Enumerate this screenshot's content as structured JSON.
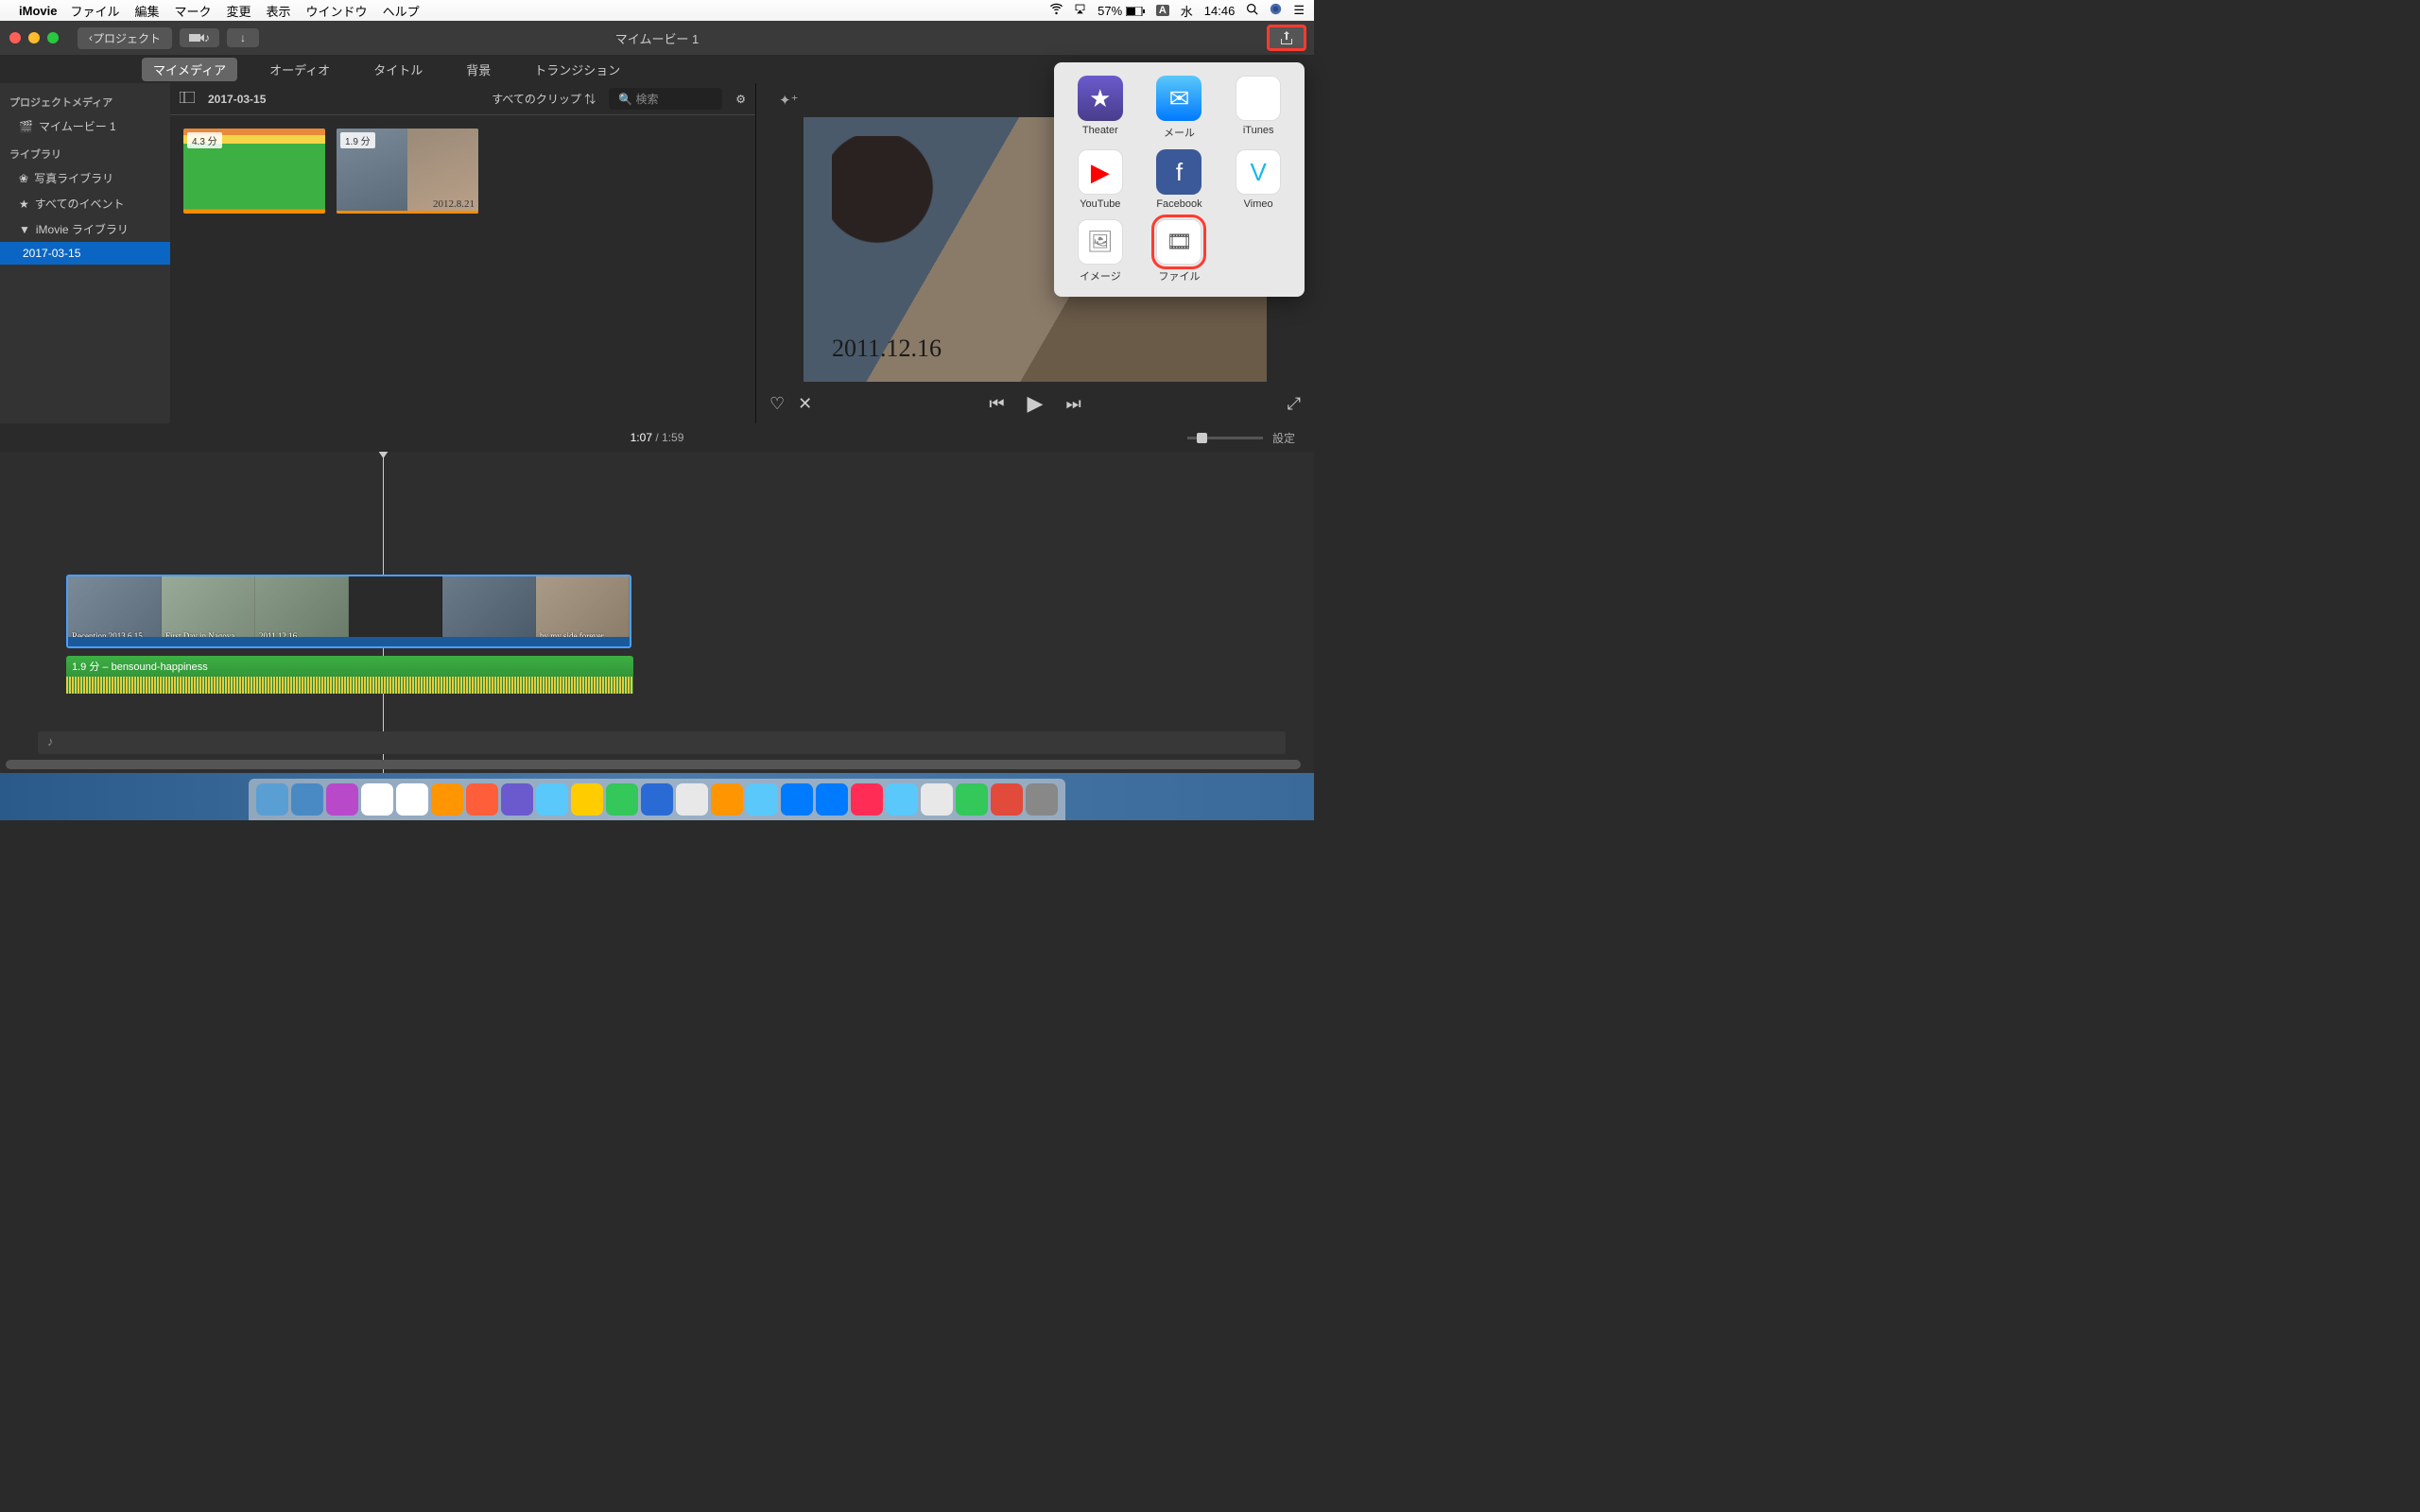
{
  "menubar": {
    "app": "iMovie",
    "items": [
      "ファイル",
      "編集",
      "マーク",
      "変更",
      "表示",
      "ウインドウ",
      "ヘルプ"
    ],
    "battery": "57%",
    "input_badge": "A",
    "day": "水",
    "time": "14:46"
  },
  "titlebar": {
    "back": "プロジェクト",
    "title": "マイムービー 1"
  },
  "tabs": {
    "items": [
      "マイメディア",
      "オーディオ",
      "タイトル",
      "背景",
      "トランジション"
    ],
    "active": 0
  },
  "sidebar": {
    "project_media": "プロジェクトメディア",
    "movie": "マイムービー 1",
    "library": "ライブラリ",
    "photo_lib": "写真ライブラリ",
    "all_events": "すべてのイベント",
    "imovie_lib": "iMovie ライブラリ",
    "event": "2017-03-15"
  },
  "browser": {
    "date": "2017-03-15",
    "filter": "すべてのクリップ",
    "search_ph": "検索",
    "clip1_dur": "4.3 分",
    "clip2_dur": "1.9 分",
    "clip2_date": "2012.8.21"
  },
  "preview": {
    "date_overlay": "2011.12.16"
  },
  "share": {
    "items": [
      {
        "label": "Theater",
        "cls": "pi-theater",
        "glyph": "★"
      },
      {
        "label": "メール",
        "cls": "pi-mail",
        "glyph": "✉"
      },
      {
        "label": "iTunes",
        "cls": "pi-itunes",
        "glyph": "♫"
      },
      {
        "label": "YouTube",
        "cls": "pi-youtube",
        "glyph": "▶"
      },
      {
        "label": "Facebook",
        "cls": "pi-facebook",
        "glyph": "f"
      },
      {
        "label": "Vimeo",
        "cls": "pi-vimeo",
        "glyph": "V"
      },
      {
        "label": "イメージ",
        "cls": "pi-image",
        "glyph": "🖼"
      },
      {
        "label": "ファイル",
        "cls": "pi-file",
        "glyph": "🎞"
      }
    ],
    "highlighted": 7
  },
  "timecode": {
    "current": "1:07",
    "total": "1:59",
    "settings": "設定"
  },
  "timeline": {
    "frame_texts": [
      "Reception 2013.6.15",
      "First Day in Nagoya",
      "2011.12.16",
      "",
      "",
      "by my side forever"
    ],
    "audio_label": "1.9 分 – bensound-happiness"
  },
  "dock_colors": [
    "#5a9fd4",
    "#4a8ac4",
    "#b84aca",
    "#fff",
    "#fff",
    "#ff9500",
    "#ff5e3a",
    "#6a5acd",
    "#5ac8fa",
    "#ffcc00",
    "#34c759",
    "#2a6ad4",
    "#e8e8e8",
    "#ff9500",
    "#5ac8fa",
    "#007aff",
    "#007aff",
    "#ff2d55",
    "#5ac8fa",
    "#e8e8e8",
    "#34c759",
    "#e24a3b",
    "#888"
  ]
}
